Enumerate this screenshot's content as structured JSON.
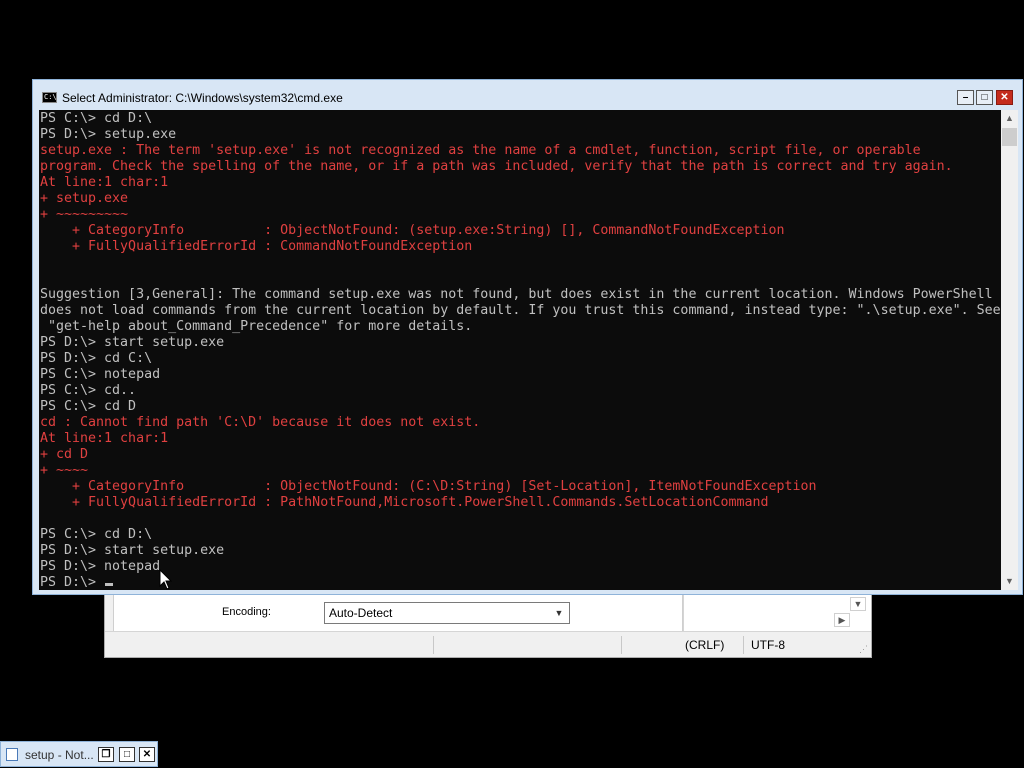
{
  "background_dialog": {
    "encoding_label": "Encoding:",
    "encoding_value": "Auto-Detect",
    "status_line_ending": "(CRLF)",
    "status_encoding": "UTF-8"
  },
  "console": {
    "title": "Select Administrator: C:\\Windows\\system32\\cmd.exe",
    "icon_text": "C:\\",
    "colors": {
      "background": "#0c0c0c",
      "text": "#c0c0c0",
      "error": "#e04040"
    },
    "lines": [
      {
        "text": "PS C:\\> cd D:\\",
        "error": false
      },
      {
        "text": "PS D:\\> setup.exe",
        "error": false
      },
      {
        "text": "setup.exe : The term 'setup.exe' is not recognized as the name of a cmdlet, function, script file, or operable",
        "error": true
      },
      {
        "text": "program. Check the spelling of the name, or if a path was included, verify that the path is correct and try again.",
        "error": true
      },
      {
        "text": "At line:1 char:1",
        "error": true
      },
      {
        "text": "+ setup.exe",
        "error": true
      },
      {
        "text": "+ ~~~~~~~~~",
        "error": true
      },
      {
        "text": "    + CategoryInfo          : ObjectNotFound: (setup.exe:String) [], CommandNotFoundException",
        "error": true
      },
      {
        "text": "    + FullyQualifiedErrorId : CommandNotFoundException",
        "error": true
      },
      {
        "text": "",
        "error": false
      },
      {
        "text": "",
        "error": false
      },
      {
        "text": "Suggestion [3,General]: The command setup.exe was not found, but does exist in the current location. Windows PowerShell",
        "error": false
      },
      {
        "text": "does not load commands from the current location by default. If you trust this command, instead type: \".\\setup.exe\". See",
        "error": false
      },
      {
        "text": " \"get-help about_Command_Precedence\" for more details.",
        "error": false
      },
      {
        "text": "PS D:\\> start setup.exe",
        "error": false
      },
      {
        "text": "PS D:\\> cd C:\\",
        "error": false
      },
      {
        "text": "PS C:\\> notepad",
        "error": false
      },
      {
        "text": "PS C:\\> cd..",
        "error": false
      },
      {
        "text": "PS C:\\> cd D",
        "error": false
      },
      {
        "text": "cd : Cannot find path 'C:\\D' because it does not exist.",
        "error": true
      },
      {
        "text": "At line:1 char:1",
        "error": true
      },
      {
        "text": "+ cd D",
        "error": true
      },
      {
        "text": "+ ~~~~",
        "error": true
      },
      {
        "text": "    + CategoryInfo          : ObjectNotFound: (C:\\D:String) [Set-Location], ItemNotFoundException",
        "error": true
      },
      {
        "text": "    + FullyQualifiedErrorId : PathNotFound,Microsoft.PowerShell.Commands.SetLocationCommand",
        "error": true
      },
      {
        "text": "",
        "error": false
      },
      {
        "text": "PS C:\\> cd D:\\",
        "error": false
      },
      {
        "text": "PS D:\\> start setup.exe",
        "error": false
      },
      {
        "text": "PS D:\\> notepad",
        "error": false
      },
      {
        "text": "PS D:\\>",
        "error": false
      }
    ]
  },
  "taskbar_item": {
    "label": "setup - Not..."
  }
}
